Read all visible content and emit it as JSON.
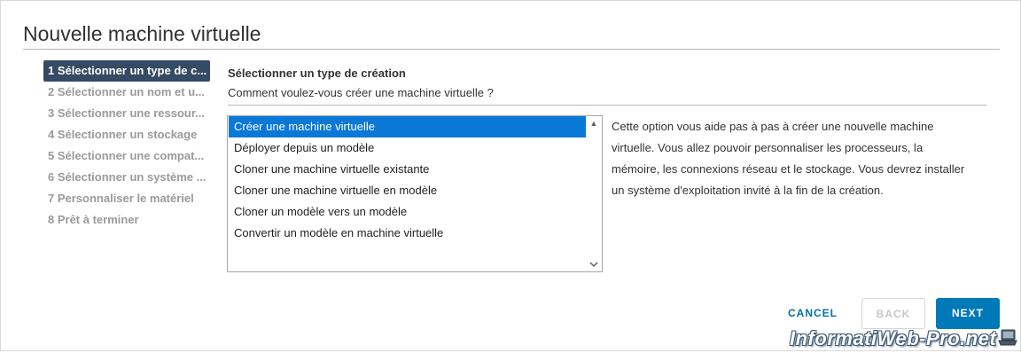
{
  "dialog": {
    "title": "Nouvelle machine virtuelle"
  },
  "steps": [
    {
      "label": "1 Sélectionner un type de c...",
      "active": true
    },
    {
      "label": "2 Sélectionner un nom et u...",
      "active": false
    },
    {
      "label": "3 Sélectionner une ressour...",
      "active": false
    },
    {
      "label": "4 Sélectionner un stockage",
      "active": false
    },
    {
      "label": "5 Sélectionner une compat...",
      "active": false
    },
    {
      "label": "6 Sélectionner un système ...",
      "active": false
    },
    {
      "label": "7 Personnaliser le matériel",
      "active": false
    },
    {
      "label": "8 Prêt à terminer",
      "active": false
    }
  ],
  "content": {
    "heading": "Sélectionner un type de création",
    "question": "Comment voulez-vous créer une machine virtuelle ?",
    "options": [
      "Créer une machine virtuelle",
      "Déployer depuis un modèle",
      "Cloner une machine virtuelle existante",
      "Cloner une machine virtuelle en modèle",
      "Cloner un modèle vers un modèle",
      "Convertir un modèle en machine virtuelle"
    ],
    "selected_option": "Créer une machine virtuelle",
    "description": "Cette option vous aide pas à pas à créer une nouvelle machine virtuelle. Vous allez pouvoir personnaliser les processeurs, la mémoire, les connexions réseau et le stockage. Vous devrez installer un système d'exploitation invité à la fin de la création."
  },
  "footer": {
    "cancel_label": "CANCEL",
    "back_label": "BACK",
    "next_label": "NEXT"
  },
  "watermark": {
    "text": "InformatiWeb-Pro.net"
  },
  "colors": {
    "active_step_bg": "#354a63",
    "selected_option_bg": "#0a78d7",
    "primary_button": "#0079b8",
    "link_button": "#0072a3"
  }
}
